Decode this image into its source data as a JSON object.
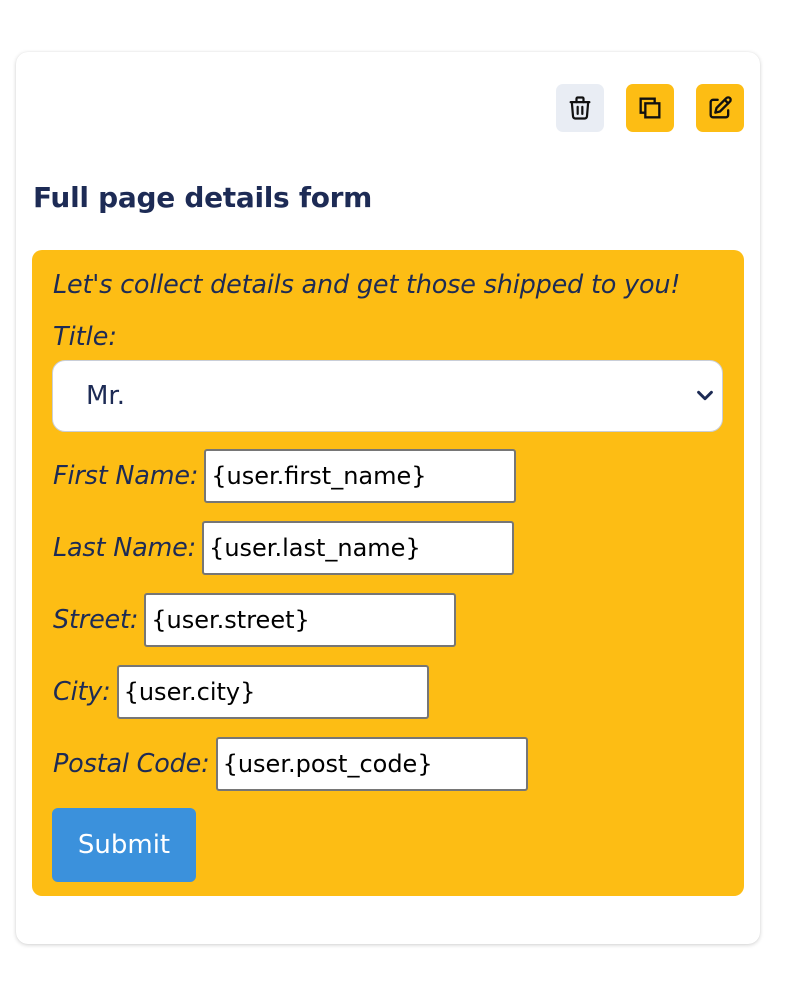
{
  "toolbar": {
    "delete_icon": "trash-icon",
    "duplicate_icon": "copy-icon",
    "edit_icon": "edit-icon"
  },
  "card": {
    "title": "Full page details form"
  },
  "form": {
    "intro": "Let's collect details and get those shipped to you!",
    "title_label": "Title:",
    "title_selected": "Mr.",
    "fields": {
      "first_name": {
        "label": "First Name:",
        "value": "{user.first_name}"
      },
      "last_name": {
        "label": "Last Name:",
        "value": "{user.last_name}"
      },
      "street": {
        "label": "Street:",
        "value": "{user.street}"
      },
      "city": {
        "label": "City:",
        "value": "{user.city}"
      },
      "postal_code": {
        "label": "Postal Code:",
        "value": "{user.post_code}"
      }
    },
    "submit_label": "Submit"
  },
  "colors": {
    "panel": "#fdbd14",
    "text": "#1d2b55",
    "submit": "#3b91dc",
    "delete_button_bg": "#e9edf4"
  }
}
